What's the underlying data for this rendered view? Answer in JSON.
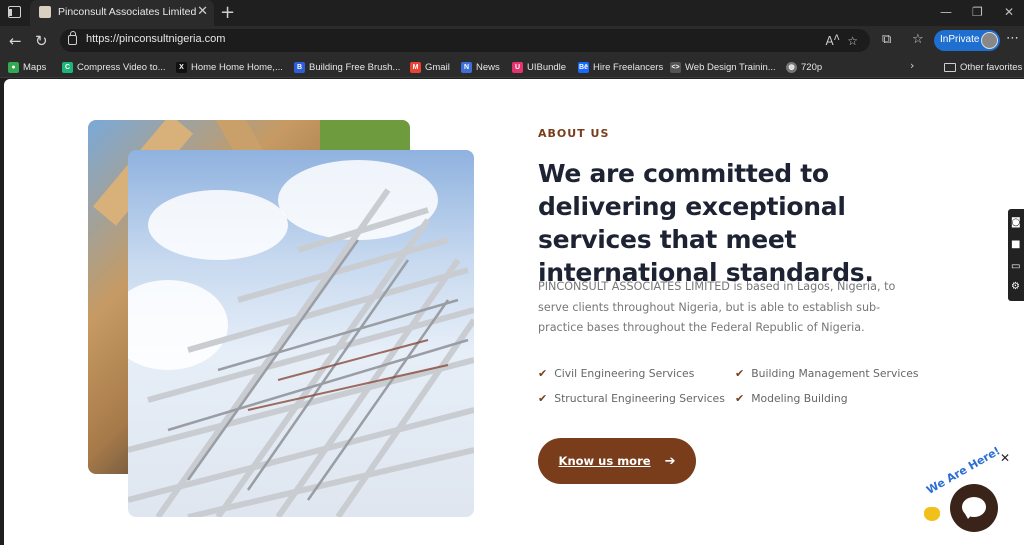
{
  "browser": {
    "tab_title": "Pinconsult Associates Limited",
    "url": "https://pinconsultnigeria.com",
    "inprivate_label": "InPrivate",
    "favorites": [
      {
        "label": "Maps",
        "color": "#34a853"
      },
      {
        "label": "Compress Video to...",
        "color": "#1fb57a"
      },
      {
        "label": "Home Home Home,...",
        "color": "#111111"
      },
      {
        "label": "Building Free Brush...",
        "color": "#2f5fd6"
      },
      {
        "label": "Gmail",
        "color": "#ea4335"
      },
      {
        "label": "News",
        "color": "#3d6fd8"
      },
      {
        "label": "UIBundle",
        "color": "#e5336f"
      },
      {
        "label": "Hire Freelancers",
        "color": "#1769ff"
      },
      {
        "label": "Web Design Trainin...",
        "color": "#555555"
      },
      {
        "label": "720p",
        "color": "#777777"
      }
    ],
    "other_favorites": "Other favorites"
  },
  "about": {
    "label": "ABOUT US",
    "heading": "We are committed to delivering exceptional services that meet international standards.",
    "description": "PINCONSULT ASSOCIATES LIMITED is based in Lagos, Nigeria, to serve clients throughout Nigeria, but is able to establish sub- practice bases throughout the Federal Republic of Nigeria.",
    "services": [
      "Civil Engineering Services",
      "Building Management Services",
      "Structural Engineering Services",
      "Modeling Building"
    ],
    "cta_label": "Know us more"
  },
  "chat": {
    "tag": "We Are Here!"
  },
  "colors": {
    "accent": "#7a3d1c",
    "heading": "#1d2333",
    "inprivate": "#1f6fd0"
  }
}
